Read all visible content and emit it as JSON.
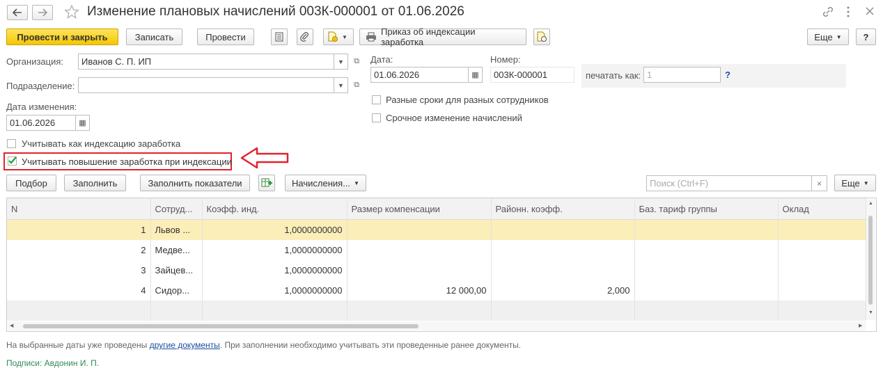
{
  "window": {
    "title": "Изменение плановых начислений 003К-000001 от 01.06.2026"
  },
  "toolbar": {
    "post_close": "Провести и закрыть",
    "save": "Записать",
    "post": "Провести",
    "indexation_order": "Приказ об индексации заработка",
    "more": "Еще",
    "help": "?"
  },
  "form": {
    "org_label": "Организация:",
    "org_value": "Иванов С. П. ИП",
    "dept_label": "Подразделение:",
    "dept_value": "",
    "change_date_label": "Дата изменения:",
    "change_date_value": "01.06.2026",
    "date_label": "Дата:",
    "date_value": "01.06.2026",
    "number_label": "Номер:",
    "number_value": "003К-000001",
    "print_as_label": "печатать как:",
    "print_as_placeholder": "1",
    "print_help": "?",
    "cb_diff_dates": "Разные сроки для разных сотрудников",
    "cb_urgent": "Срочное изменение начислений",
    "cb_as_indexation": "Учитывать как индексацию заработка",
    "cb_increase": "Учитывать повышение заработка при индексации"
  },
  "table_toolbar": {
    "pick": "Подбор",
    "fill": "Заполнить",
    "fill_indicators": "Заполнить показатели",
    "accruals": "Начисления...",
    "search_placeholder": "Поиск (Ctrl+F)",
    "more": "Еще"
  },
  "table": {
    "columns": [
      "N",
      "Сотруд...",
      "Коэфф. инд.",
      "Размер компенсации",
      "Районн. коэфф.",
      "Баз. тариф группы",
      "Оклад"
    ],
    "rows": [
      {
        "n": "1",
        "emp": "Львов ...",
        "coef": "1,0000000000",
        "comp": "",
        "reg": "",
        "base": "",
        "salary": ""
      },
      {
        "n": "2",
        "emp": "Медве...",
        "coef": "1,0000000000",
        "comp": "",
        "reg": "",
        "base": "",
        "salary": ""
      },
      {
        "n": "3",
        "emp": "Зайцев...",
        "coef": "1,0000000000",
        "comp": "",
        "reg": "",
        "base": "",
        "salary": ""
      },
      {
        "n": "4",
        "emp": "Сидор...",
        "coef": "1,0000000000",
        "comp": "12 000,00",
        "reg": "2,000",
        "base": "",
        "salary": ""
      }
    ]
  },
  "footer": {
    "note_before": "На выбранные даты уже проведены ",
    "note_link": "другие документы",
    "note_after": ". При заполнении необходимо учитывать эти проведенные ранее документы.",
    "signatures": "Подписи: Авдонин И. П."
  },
  "colors": {
    "accent_yellow": "#f5c600",
    "highlight_red": "#e3222b",
    "link_blue": "#1a4fa0",
    "signature_green": "#2e8b57",
    "selected_row": "#fbeeb8"
  }
}
